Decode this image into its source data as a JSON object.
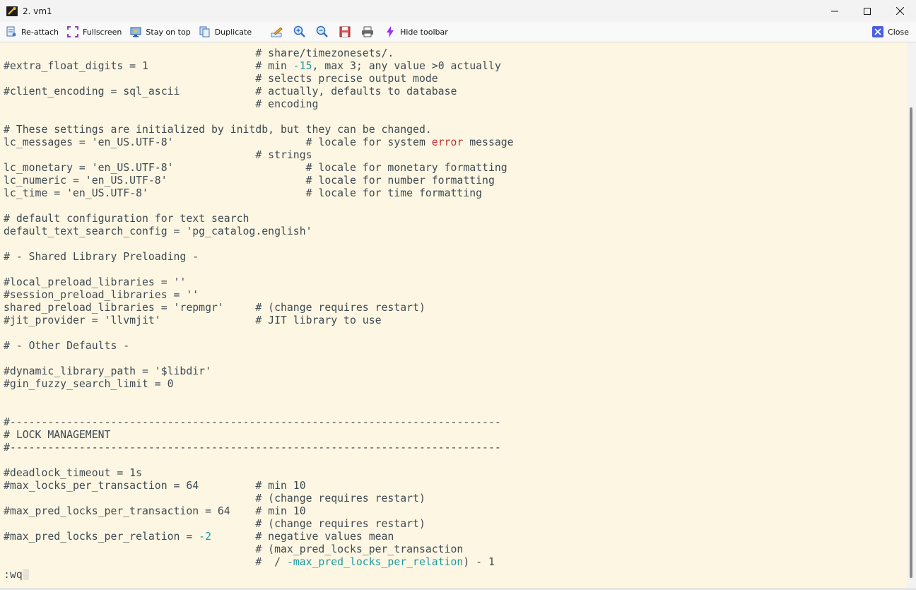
{
  "window": {
    "title": "2. vm1"
  },
  "toolbar": {
    "items": [
      {
        "label": "Re-attach",
        "icon": "reattach-icon"
      },
      {
        "label": "Fullscreen",
        "icon": "fullscreen-icon"
      },
      {
        "label": "Stay on top",
        "icon": "monitor-icon"
      },
      {
        "label": "Duplicate",
        "icon": "duplicate-icon"
      }
    ],
    "icon_buttons": [
      "edit-icon",
      "zoom-in-icon",
      "zoom-out-icon",
      "save-icon",
      "print-icon"
    ],
    "hide_label": "Hide toolbar",
    "close_label": "Close"
  },
  "terminal": {
    "lines": [
      [
        {
          "t": "                                        # share/timezonesets/."
        }
      ],
      [
        {
          "t": "#extra_float_digits = 1                 # min "
        },
        {
          "t": "-15",
          "c": "num"
        },
        {
          "t": ", max 3; any value >0 actually"
        }
      ],
      [
        {
          "t": "                                        # selects precise output mode"
        }
      ],
      [
        {
          "t": "#client_encoding = sql_ascii            # actually, defaults to database"
        }
      ],
      [
        {
          "t": "                                        # encoding"
        }
      ],
      [
        {
          "t": ""
        }
      ],
      [
        {
          "t": "# These settings are initialized by initdb, but they can be changed."
        }
      ],
      [
        {
          "t": "lc_messages = 'en_US.UTF-8'                     # locale for system "
        },
        {
          "t": "error",
          "c": "err"
        },
        {
          "t": " message"
        }
      ],
      [
        {
          "t": "                                        # strings"
        }
      ],
      [
        {
          "t": "lc_monetary = 'en_US.UTF-8'                     # locale for monetary formatting"
        }
      ],
      [
        {
          "t": "lc_numeric = 'en_US.UTF-8'                      # locale for number formatting"
        }
      ],
      [
        {
          "t": "lc_time = 'en_US.UTF-8'                         # locale for time formatting"
        }
      ],
      [
        {
          "t": ""
        }
      ],
      [
        {
          "t": "# default configuration for text search"
        }
      ],
      [
        {
          "t": "default_text_search_config = 'pg_catalog.english'"
        }
      ],
      [
        {
          "t": ""
        }
      ],
      [
        {
          "t": "# - Shared Library Preloading -"
        }
      ],
      [
        {
          "t": ""
        }
      ],
      [
        {
          "t": "#local_preload_libraries = ''"
        }
      ],
      [
        {
          "t": "#session_preload_libraries = ''"
        }
      ],
      [
        {
          "t": "shared_preload_libraries = 'repmgr'     # (change requires restart)"
        }
      ],
      [
        {
          "t": "#jit_provider = 'llvmjit'               # JIT library to use"
        }
      ],
      [
        {
          "t": ""
        }
      ],
      [
        {
          "t": "# - Other Defaults -"
        }
      ],
      [
        {
          "t": ""
        }
      ],
      [
        {
          "t": "#dynamic_library_path = '$libdir'"
        }
      ],
      [
        {
          "t": "#gin_fuzzy_search_limit = 0"
        }
      ],
      [
        {
          "t": ""
        }
      ],
      [
        {
          "t": ""
        }
      ],
      [
        {
          "t": "#------------------------------------------------------------------------------"
        }
      ],
      [
        {
          "t": "# LOCK MANAGEMENT"
        }
      ],
      [
        {
          "t": "#------------------------------------------------------------------------------"
        }
      ],
      [
        {
          "t": ""
        }
      ],
      [
        {
          "t": "#deadlock_timeout = 1s"
        }
      ],
      [
        {
          "t": "#max_locks_per_transaction = 64         # min 10"
        }
      ],
      [
        {
          "t": "                                        # (change requires restart)"
        }
      ],
      [
        {
          "t": "#max_pred_locks_per_transaction = 64    # min 10"
        }
      ],
      [
        {
          "t": "                                        # (change requires restart)"
        }
      ],
      [
        {
          "t": "#max_pred_locks_per_relation = "
        },
        {
          "t": "-2",
          "c": "num"
        },
        {
          "t": "       # negative values mean"
        }
      ],
      [
        {
          "t": "                                        # (max_pred_locks_per_transaction"
        }
      ],
      [
        {
          "t": "                                        #  / "
        },
        {
          "t": "-max_pred_locks_per_relation",
          "c": "num"
        },
        {
          "t": ") - 1"
        }
      ],
      [
        {
          "t": ":wq"
        }
      ]
    ]
  }
}
